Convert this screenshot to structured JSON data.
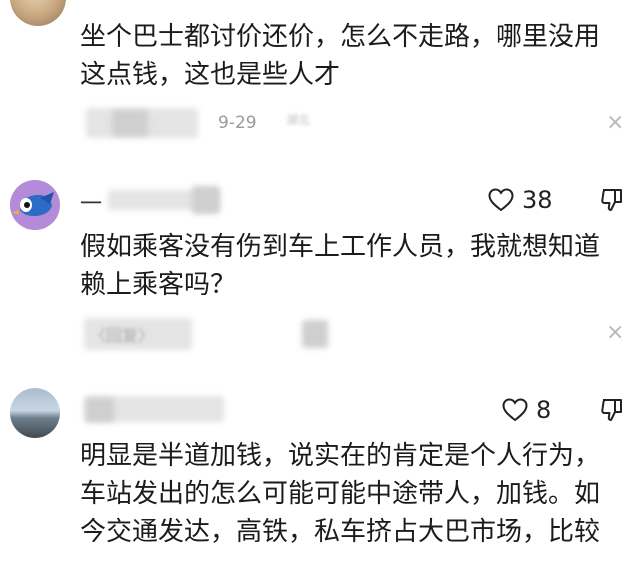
{
  "comments": [
    {
      "text_lines": [
        "坐个巴士都讨价还价，怎么不走路，哪里没用",
        "这点钱，这也是些人才"
      ],
      "meta": {
        "reply_label": "回复",
        "date": "9-29",
        "location": "湖北"
      },
      "close": "×"
    },
    {
      "username": "一",
      "likes": "38",
      "text_lines": [
        "假如乘客没有伤到车上工作人员，我就想知道",
        "赖上乘客吗？"
      ],
      "meta": {
        "reply_label": "〈回复〉"
      },
      "close": "×"
    },
    {
      "likes": "8",
      "text_lines": [
        "明显是半道加钱，说实在的肯定是个人行为，",
        "车站发出的怎么可能可能中途带人，加钱。如",
        "今交通发达，高铁，私车挤占大巴市场，比较"
      ]
    }
  ]
}
